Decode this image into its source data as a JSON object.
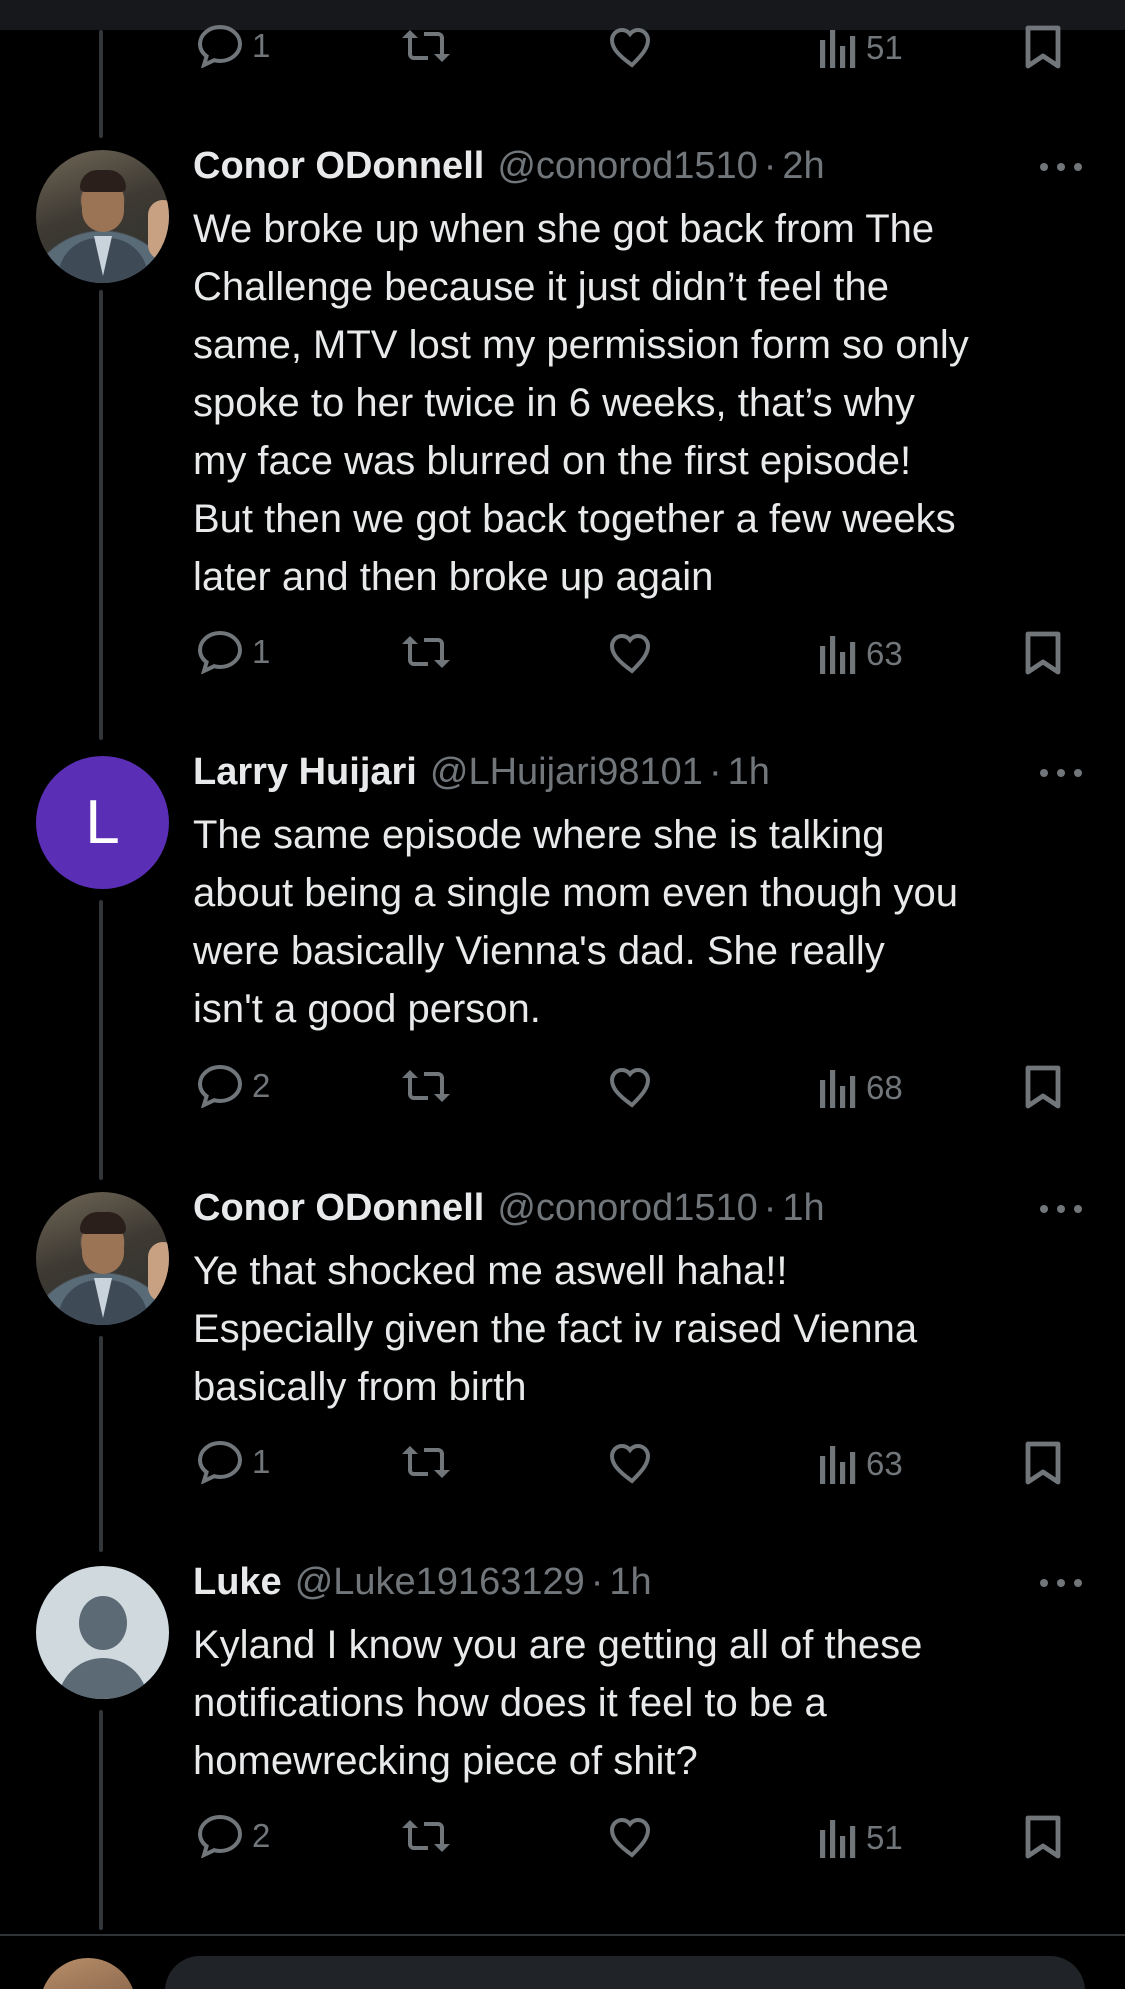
{
  "top_action_bar": {
    "reply_count": "1",
    "view_count": "51"
  },
  "tweets": [
    {
      "author_name": "Conor ODonnell",
      "handle": "@conorod1510",
      "separator": "·",
      "time": "2h",
      "text": "We broke up when she got back from The\nChallenge because it just didn’t feel the\nsame, MTV lost my permission form so only\nspoke to her twice in 6 weeks, that’s why\nmy face was blurred on the first episode!\nBut then we got back together a few weeks\nlater and then broke up again",
      "reply_count": "1",
      "view_count": "63",
      "avatar_icon": "profile-photo-icon"
    },
    {
      "author_name": "Larry Huijari",
      "handle": "@LHuijari98101",
      "separator": "·",
      "time": "1h",
      "text": "The same episode where she is talking\nabout being a single mom even though you\nwere basically Vienna's dad.  She really\nisn't a good person.",
      "reply_count": "2",
      "view_count": "68",
      "avatar_letter": "L",
      "avatar_color": "#5b2fb5"
    },
    {
      "author_name": "Conor ODonnell",
      "handle": "@conorod1510",
      "separator": "·",
      "time": "1h",
      "text": "Ye that shocked me aswell haha!!\nEspecially given the fact iv raised Vienna\nbasically from birth",
      "reply_count": "1",
      "view_count": "63",
      "avatar_icon": "profile-photo-icon"
    },
    {
      "author_name": "Luke",
      "handle": "@Luke19163129",
      "separator": "·",
      "time": "1h",
      "text": "Kyland I know you are getting all of these\nnotifications how does it feel to be a\nhomewrecking piece of shit?",
      "reply_count": "2",
      "view_count": "51",
      "avatar_icon": "default-avatar-icon"
    }
  ],
  "colors": {
    "background": "#000000",
    "text": "#e7e9ea",
    "muted": "#71767b",
    "divider": "#2f3336"
  },
  "icons": [
    "reply-icon",
    "retweet-icon",
    "like-icon",
    "views-icon",
    "bookmark-icon",
    "more-icon"
  ]
}
